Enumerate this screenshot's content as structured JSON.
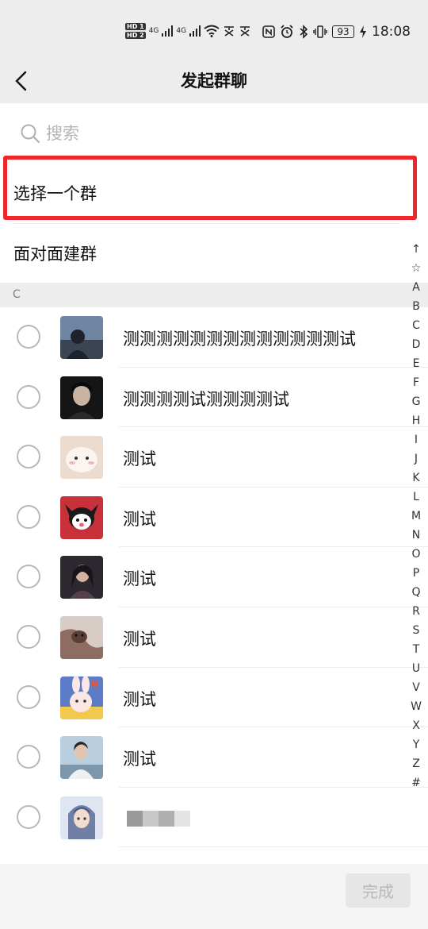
{
  "status_bar": {
    "hd1": "HD 1",
    "hd2": "HD 2",
    "signal1": "4G",
    "signal2": "4G",
    "time": "18:08",
    "battery": "93"
  },
  "nav": {
    "title": "发起群聊"
  },
  "search": {
    "placeholder": "搜索"
  },
  "menu": {
    "select_group": "选择一个群",
    "face_to_face": "面对面建群"
  },
  "section": {
    "letter": "C"
  },
  "contacts": [
    {
      "name": "测测测测测测测测测测测测测试",
      "avatar_color": "#4a5a6e"
    },
    {
      "name": "测测测测试测测测测试",
      "avatar_color": "#1e1e1e"
    },
    {
      "name": "测试",
      "avatar_color": "#e9d6c9"
    },
    {
      "name": "测试",
      "avatar_color": "#c8303a"
    },
    {
      "name": "测试",
      "avatar_color": "#3a3440"
    },
    {
      "name": "测试",
      "avatar_color": "#9a7a6e"
    },
    {
      "name": "测试",
      "avatar_color": "#5d7cc8"
    },
    {
      "name": "测试",
      "avatar_color": "#9fb6c9"
    },
    {
      "name": "",
      "avatar_color": "#8a9ab8"
    }
  ],
  "index_letters": [
    "↑",
    "☆",
    "A",
    "B",
    "C",
    "D",
    "E",
    "F",
    "G",
    "H",
    "I",
    "J",
    "K",
    "L",
    "M",
    "N",
    "O",
    "P",
    "Q",
    "R",
    "S",
    "T",
    "U",
    "V",
    "W",
    "X",
    "Y",
    "Z",
    "#"
  ],
  "bottom": {
    "done_label": "完成"
  },
  "colors": {
    "highlight": "#f0262a",
    "bar_bg": "#ededed"
  }
}
